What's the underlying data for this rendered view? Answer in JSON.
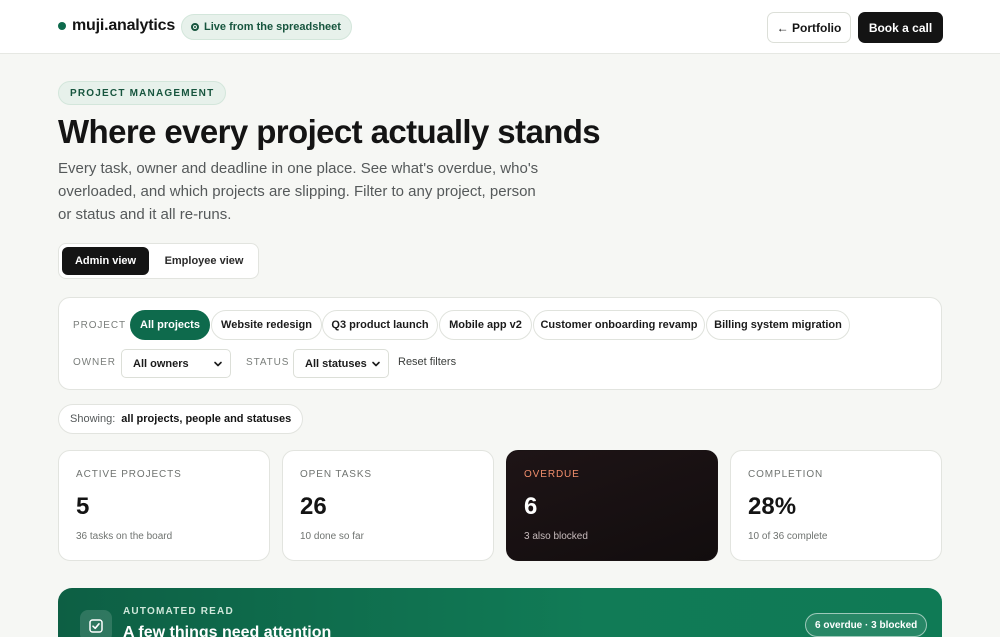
{
  "topbar": {
    "brand": "muji.analytics",
    "live_label": "Live from the spreadsheet",
    "portfolio_label": "← Portfolio",
    "book_label": "Book a call"
  },
  "hero": {
    "eyebrow": "PROJECT MANAGEMENT",
    "title": "Where every project actually stands",
    "subtitle": "Every task, owner and deadline in one place. See what's overdue, who's overloaded, and which projects are slipping. Filter to any project, person or status and it all re-runs."
  },
  "view_toggle": {
    "admin": "Admin view",
    "employee": "Employee view",
    "active": "admin"
  },
  "filters": {
    "project_label": "PROJECT",
    "projects": [
      "All projects",
      "Website redesign",
      "Q3 product launch",
      "Mobile app v2",
      "Customer onboarding revamp",
      "Billing system migration"
    ],
    "active_project": "All projects",
    "owner_label": "OWNER",
    "owner_value": "All owners",
    "status_label": "STATUS",
    "status_value": "All statuses",
    "reset_label": "Reset filters"
  },
  "showing": {
    "label": "Showing:",
    "value": "all projects, people and statuses"
  },
  "kpis": [
    {
      "label": "ACTIVE PROJECTS",
      "value": "5",
      "foot": "36 tasks on the board"
    },
    {
      "label": "OPEN TASKS",
      "value": "26",
      "foot": "10 done so far"
    },
    {
      "label": "OVERDUE",
      "value": "6",
      "foot": "3 also blocked"
    },
    {
      "label": "COMPLETION",
      "value": "28%",
      "foot": "10 of 36 complete"
    }
  ],
  "banner": {
    "eyebrow": "AUTOMATED READ",
    "title": "A few things need attention",
    "badge": "6 overdue · 3 blocked"
  },
  "colors": {
    "accent": "#0e6a4c",
    "dark_card": "#141012",
    "overdue_label": "#f08d6b",
    "background": "#f6f7f4"
  },
  "icons": {
    "brand": "dot-icon",
    "live": "radio-dot-icon",
    "select": "chevron-down-icon",
    "banner": "checkbox-icon"
  }
}
